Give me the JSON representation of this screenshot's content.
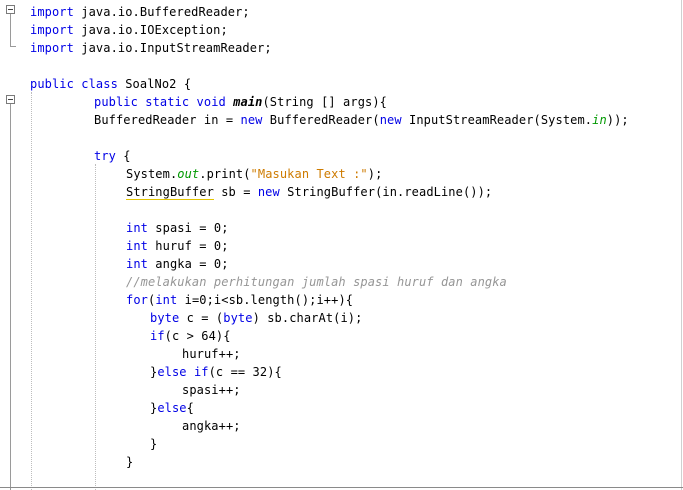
{
  "editor": {
    "lines": [
      {
        "indent": 0,
        "parts": [
          {
            "t": "import",
            "c": "kw"
          },
          {
            "t": " java.io.BufferedReader;"
          }
        ]
      },
      {
        "indent": 0,
        "parts": [
          {
            "t": "import",
            "c": "kw"
          },
          {
            "t": " java.io.IOException;"
          }
        ]
      },
      {
        "indent": 0,
        "parts": [
          {
            "t": "import",
            "c": "kw"
          },
          {
            "t": " java.io.InputStreamReader;"
          }
        ]
      },
      {
        "indent": 0,
        "parts": []
      },
      {
        "indent": 0,
        "parts": [
          {
            "t": "public class",
            "c": "kw"
          },
          {
            "t": " SoalNo2 {"
          }
        ]
      },
      {
        "indent": 1,
        "parts": [
          {
            "t": "public static void",
            "c": "kw"
          },
          {
            "t": " "
          },
          {
            "t": "main",
            "c": "mth"
          },
          {
            "t": "(String [] args){"
          }
        ]
      },
      {
        "indent": 1,
        "parts": [
          {
            "t": "BufferedReader in = "
          },
          {
            "t": "new",
            "c": "kw"
          },
          {
            "t": " BufferedReader("
          },
          {
            "t": "new",
            "c": "kw"
          },
          {
            "t": " InputStreamReader(System."
          },
          {
            "t": "in",
            "c": "fld"
          },
          {
            "t": "));"
          }
        ]
      },
      {
        "indent": 1,
        "parts": []
      },
      {
        "indent": 1,
        "parts": [
          {
            "t": "try",
            "c": "kw"
          },
          {
            "t": " {"
          }
        ]
      },
      {
        "indent": 2,
        "parts": [
          {
            "t": "System."
          },
          {
            "t": "out",
            "c": "fld"
          },
          {
            "t": ".print("
          },
          {
            "t": "\"Masukan Text :\"",
            "c": "str"
          },
          {
            "t": ");"
          }
        ]
      },
      {
        "indent": 2,
        "parts": [
          {
            "t": "StringBuffer",
            "c": "hl"
          },
          {
            "t": " sb = "
          },
          {
            "t": "new",
            "c": "kw"
          },
          {
            "t": " StringBuffer(in.readLine());"
          }
        ]
      },
      {
        "indent": 2,
        "parts": []
      },
      {
        "indent": 2,
        "parts": [
          {
            "t": "int",
            "c": "kw"
          },
          {
            "t": " spasi = 0;"
          }
        ]
      },
      {
        "indent": 2,
        "parts": [
          {
            "t": "int",
            "c": "kw"
          },
          {
            "t": " huruf = 0;"
          }
        ]
      },
      {
        "indent": 2,
        "parts": [
          {
            "t": "int",
            "c": "kw"
          },
          {
            "t": " angka = 0;"
          }
        ]
      },
      {
        "indent": 2,
        "parts": [
          {
            "t": "//melakukan perhitungan jumlah spasi huruf dan angka",
            "c": "cmt"
          }
        ]
      },
      {
        "indent": 2,
        "parts": [
          {
            "t": "for",
            "c": "kw"
          },
          {
            "t": "("
          },
          {
            "t": "int",
            "c": "kw"
          },
          {
            "t": " i=0;i<sb.length();i++){"
          }
        ]
      },
      {
        "indent": 3,
        "parts": [
          {
            "t": "byte",
            "c": "kw"
          },
          {
            "t": " c = ("
          },
          {
            "t": "byte",
            "c": "kw"
          },
          {
            "t": ") sb.charAt(i);"
          }
        ]
      },
      {
        "indent": 3,
        "parts": [
          {
            "t": "if",
            "c": "kw"
          },
          {
            "t": "(c > 64){"
          }
        ]
      },
      {
        "indent": 4,
        "parts": [
          {
            "t": "huruf++;"
          }
        ]
      },
      {
        "indent": 3,
        "parts": [
          {
            "t": "}"
          },
          {
            "t": "else if",
            "c": "kw"
          },
          {
            "t": "(c == 32){"
          }
        ]
      },
      {
        "indent": 4,
        "parts": [
          {
            "t": "spasi++;"
          }
        ]
      },
      {
        "indent": 3,
        "parts": [
          {
            "t": "}"
          },
          {
            "t": "else",
            "c": "kw"
          },
          {
            "t": "{"
          }
        ]
      },
      {
        "indent": 4,
        "parts": [
          {
            "t": "angka++;"
          }
        ]
      },
      {
        "indent": 3,
        "parts": [
          {
            "t": "}"
          }
        ]
      },
      {
        "indent": 2,
        "parts": [
          {
            "t": "}"
          }
        ]
      }
    ]
  }
}
